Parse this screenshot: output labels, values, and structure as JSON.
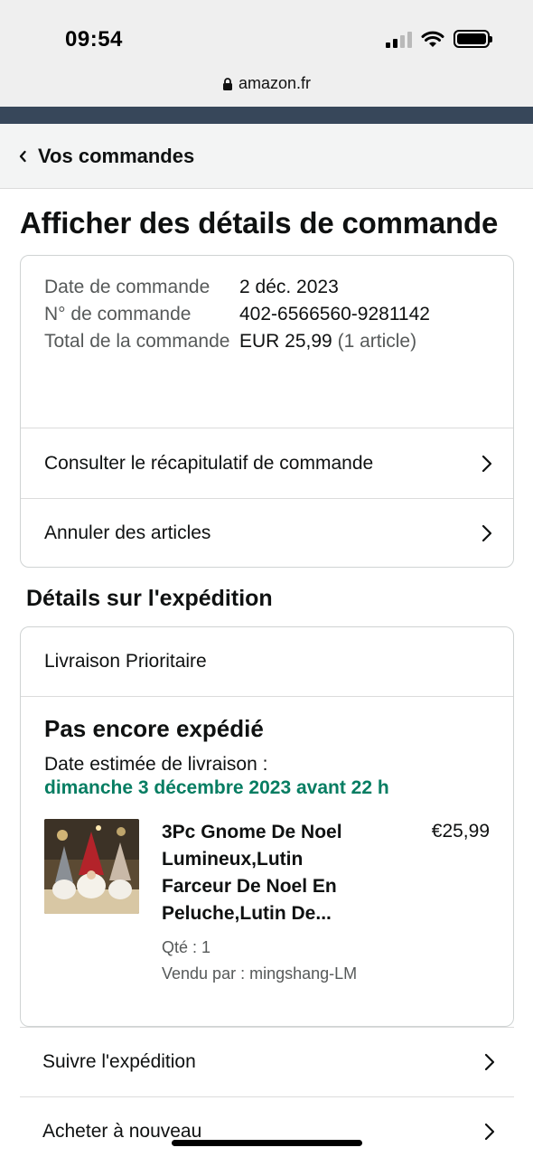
{
  "status_bar": {
    "time": "09:54"
  },
  "browser": {
    "url": "amazon.fr"
  },
  "nav": {
    "back_label": "Vos commandes"
  },
  "page": {
    "title": "Afficher des détails de commande"
  },
  "order_summary": {
    "date_label": "Date de commande",
    "date_value": "2 déc. 2023",
    "number_label": "N° de commande",
    "number_value": "402-6566560-9281142",
    "total_label": "Total de la commande",
    "total_value": "EUR 25,99",
    "total_count": "(1 article)"
  },
  "order_links": [
    {
      "label": "Consulter le récapitulatif de commande"
    },
    {
      "label": "Annuler des articles"
    }
  ],
  "shipping": {
    "section_title": "Détails sur l'expédition",
    "method": "Livraison Prioritaire",
    "status": "Pas encore expédié",
    "estimate_label": "Date estimée de livraison :",
    "estimate_date": "dimanche 3 décembre 2023 avant 22 h",
    "item": {
      "title_lines": [
        "3Pc Gnome De Noel",
        "Lumineux,Lutin",
        "Farceur De Noel En",
        "Peluche,Lutin De..."
      ],
      "price": "€25,99",
      "quantity": "Qté : 1",
      "seller": "Vendu par : mingshang-LM"
    }
  },
  "actions": [
    {
      "label": "Suivre l'expédition"
    },
    {
      "label": "Acheter à nouveau"
    }
  ],
  "colors": {
    "delivery_green": "#067d62",
    "nav_strip": "#37475a"
  }
}
